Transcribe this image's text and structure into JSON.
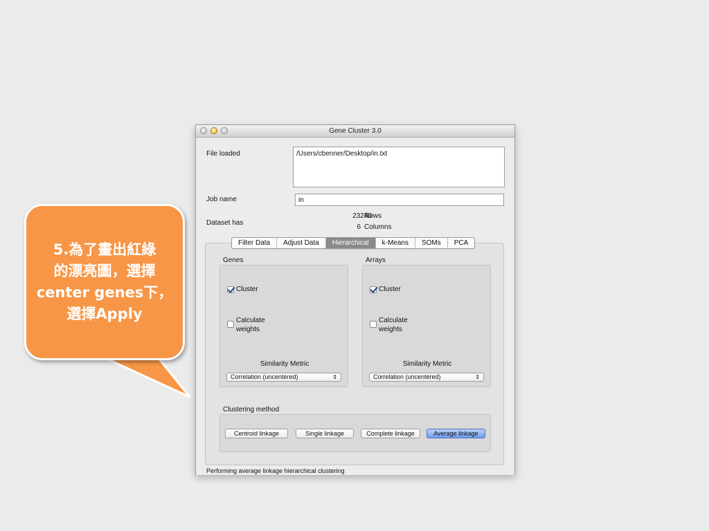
{
  "callout": {
    "text": "5.為了畫出紅綠\n的漂亮圖，選擇\ncenter genes下，\n選擇Apply",
    "color": "#f79646"
  },
  "window": {
    "title": "Gene Cluster 3.0",
    "file_loaded_label": "File loaded",
    "file_path": "/Users/cbenner/Desktop/in.txt",
    "job_name_label": "Job name",
    "job_name_value": "in",
    "dataset_label": "Dataset has",
    "rows_count": "23240",
    "rows_label": "Rows",
    "columns_count": "6",
    "columns_label": "Columns",
    "tabs": [
      {
        "label": "Filter Data",
        "active": false
      },
      {
        "label": "Adjust Data",
        "active": false
      },
      {
        "label": "Hierarchical",
        "active": true
      },
      {
        "label": "k-Means",
        "active": false
      },
      {
        "label": "SOMs",
        "active": false
      },
      {
        "label": "PCA",
        "active": false
      }
    ],
    "genes": {
      "title": "Genes",
      "cluster_label": "Cluster",
      "cluster_checked": true,
      "weights_label": "Calculate\nweights",
      "weights_checked": false,
      "similarity_label": "Similarity Metric",
      "similarity_value": "Correlation (uncentered)"
    },
    "arrays": {
      "title": "Arrays",
      "cluster_label": "Cluster",
      "cluster_checked": true,
      "weights_label": "Calculate\nweights",
      "weights_checked": false,
      "similarity_label": "Similarity Metric",
      "similarity_value": "Correlation (uncentered)"
    },
    "clustering_method_label": "Clustering method",
    "methods": {
      "centroid": "Centroid linkage",
      "single": "Single linkage",
      "complete": "Complete linkage",
      "average": "Average linkage"
    },
    "status": "Performing average linkage hierarchical clustering"
  }
}
